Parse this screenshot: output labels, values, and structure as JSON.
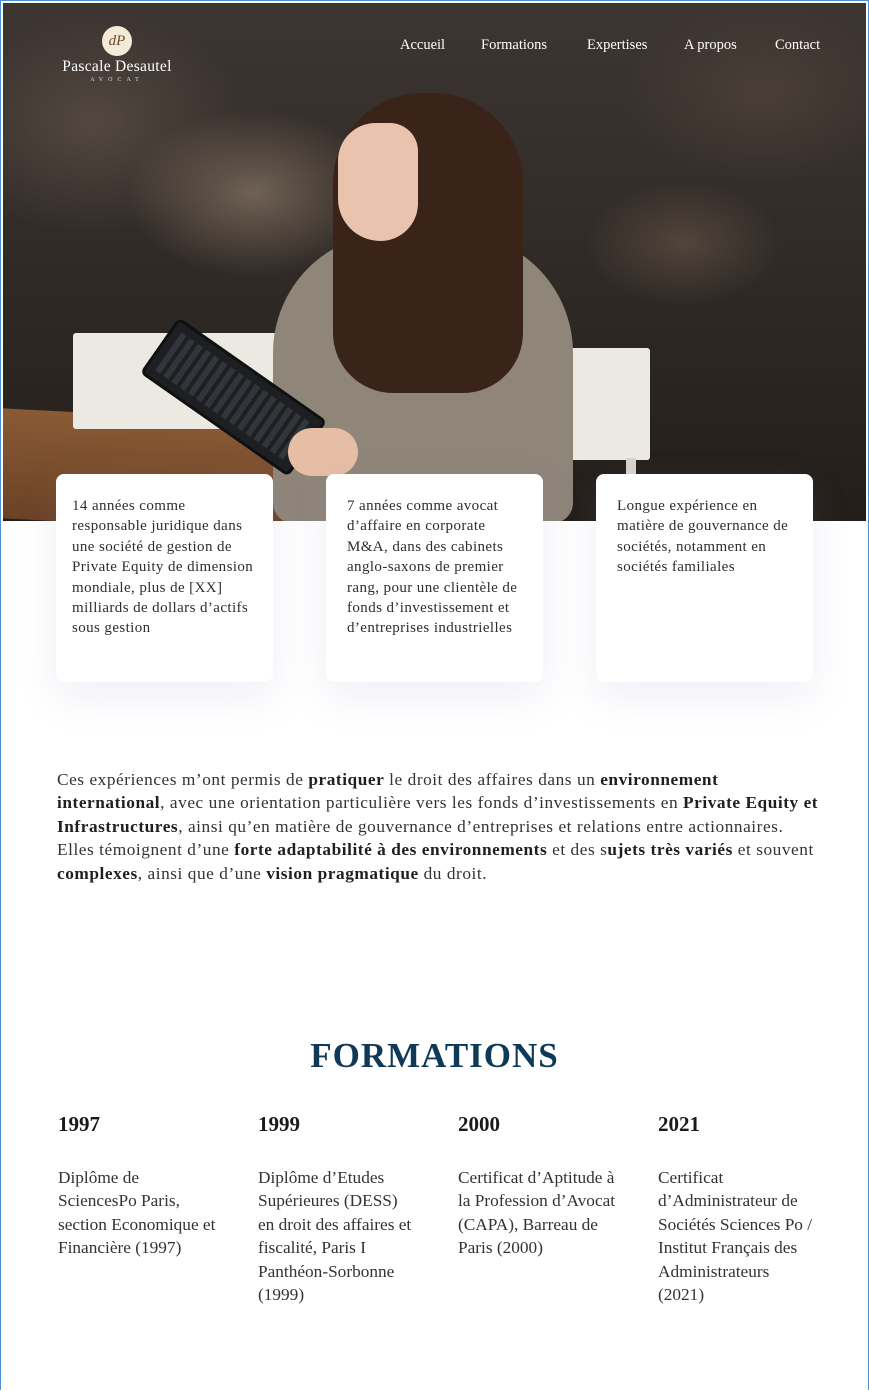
{
  "brand": {
    "monogram": "dP",
    "name": "Pascale Desautel",
    "subtitle": "AVOCAT"
  },
  "nav": {
    "items": [
      {
        "label": "Accueil"
      },
      {
        "label": "Formations"
      },
      {
        "label": "Expertises"
      },
      {
        "label": "A propos"
      },
      {
        "label": "Contact"
      }
    ]
  },
  "cards": [
    {
      "text": "14 années comme responsable juridique dans une société de gestion de Private Equity de dimension mondiale, plus de [XX] milliards de dollars d’actifs sous gestion"
    },
    {
      "text": "7 années comme avocat d’affaire en corporate M&A, dans des cabinets anglo-saxons de premier rang, pour une clientèle de fonds d’investissement et d’entreprises industrielles"
    },
    {
      "text": "Longue expérience en matière de gouvernance de sociétés, notamment en sociétés familiales"
    }
  ],
  "intro": {
    "p1": {
      "t1": "Ces expériences m’ont permis de ",
      "b1": "pratiquer",
      "t2": " le droit des affaires dans un ",
      "b2": "environnement international",
      "t3": ", avec une orientation particulière vers les fonds d’investissements en ",
      "b3": "Private Equity et Infrastructures",
      "t4": ", ainsi qu’en matière de gouvernance d’entreprises et relations entre actionnaires."
    },
    "p2": {
      "t1": "Elles témoignent d’une ",
      "b1": "forte adaptabilité à des environnements",
      "t2": " et des s",
      "b2": "ujets très variés",
      "t3": " et souvent ",
      "b3": "complexes",
      "t4": ", ainsi que d’une ",
      "b4": "vision pragmatique",
      "t5": " du droit."
    }
  },
  "formations": {
    "title": "FORMATIONS",
    "items": [
      {
        "year": "1997",
        "description": "Diplôme de SciencesPo Paris, section Economique et Financière (1997)"
      },
      {
        "year": "1999",
        "description": "Diplôme d’Etudes Supérieures (DESS) en droit des affaires et fiscalité, Paris I Panthéon-Sorbonne (1999)"
      },
      {
        "year": "2000",
        "description": "Certificat d’Aptitude à la Profession d’Avocat (CAPA), Barreau de Paris (2000)"
      },
      {
        "year": "2021",
        "description": "Certificat d’Administrateur de Sociétés Sciences Po / Institut Français des Administrateurs (2021)"
      }
    ]
  }
}
